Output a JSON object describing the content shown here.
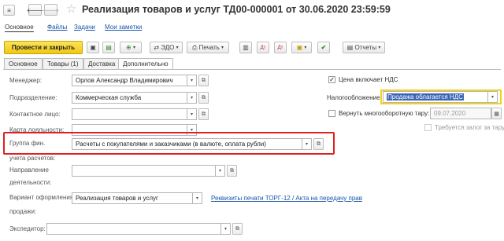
{
  "window": {
    "title": "Реализация товаров и услуг ТД00-000001 от 30.06.2020 23:59:59"
  },
  "nav_tabs": [
    {
      "label": "Основное"
    },
    {
      "label": "Файлы"
    },
    {
      "label": "Задачи"
    },
    {
      "label": "Мои заметки"
    }
  ],
  "toolbar": {
    "post_close": "Провести и закрыть",
    "edo": "ЭДО",
    "print": "Печать",
    "reports": "Отчеты"
  },
  "form_tabs": [
    {
      "label": "Основное"
    },
    {
      "label": "Товары (1)"
    },
    {
      "label": "Доставка"
    },
    {
      "label": "Дополнительно"
    }
  ],
  "fields": {
    "manager": {
      "label": "Менеджер:",
      "value": "Орлов Александр Владимирович"
    },
    "division": {
      "label": "Подразделение:",
      "value": "Коммерческая служба"
    },
    "contact": {
      "label": "Контактное лицо:",
      "value": ""
    },
    "loyalty": {
      "label": "Карта лояльности:",
      "value": ""
    },
    "fin_group": {
      "label1": "Группа фин.",
      "label2": "учета расчетов:",
      "value": "Расчеты с покупателями и заказчиками (в валюте, оплата рубли)"
    },
    "direction": {
      "label1": "Направление",
      "label2": "деятельности:",
      "value": ""
    },
    "variant": {
      "label1": "Вариант оформления",
      "label2": "продажи:",
      "value": "Реализация товаров и услуг",
      "link": "Реквизиты печати ТОРГ-12 / Акта на передачу прав"
    },
    "forwarder": {
      "label": "Экспедитор:",
      "value": ""
    }
  },
  "right": {
    "vat_included": "Цена включает НДС",
    "taxation_label": "Налогообложение:",
    "taxation_value": "Продажа облагается НДС",
    "return_tare": "Вернуть многооборотную тару:",
    "return_date": "09.07.2020",
    "deposit": "Требуется залог за тару"
  },
  "colors": {
    "accent": "#f4d11c",
    "highlight_box": "#e02020",
    "link": "#1a56a8"
  }
}
